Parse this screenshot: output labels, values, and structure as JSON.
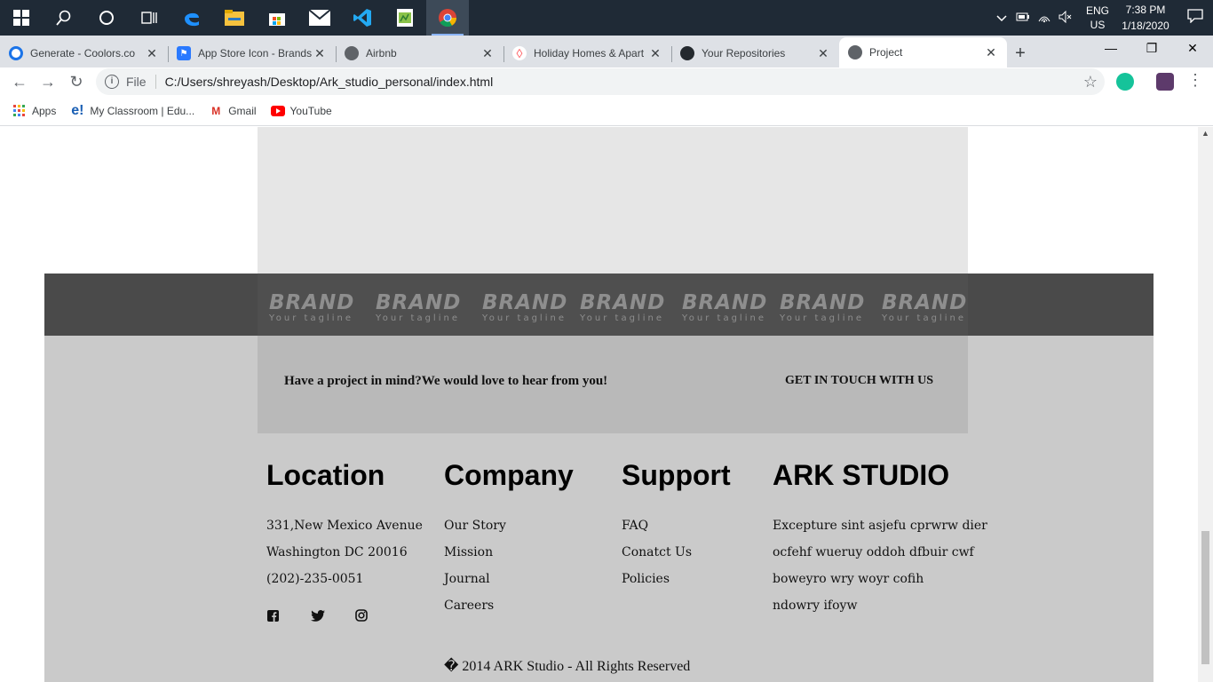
{
  "taskbar": {
    "colors": {
      "bg": "#1f2a36"
    },
    "icons": [
      "windows-icon",
      "search-icon",
      "cortana-icon",
      "task-view-icon",
      "edge-icon",
      "file-explorer-icon",
      "store-icon",
      "mail-icon",
      "vscode-icon",
      "notepad-icon",
      "chrome-icon"
    ],
    "lang_top": "ENG",
    "lang_bottom": "US",
    "time": "7:38 PM",
    "date": "1/18/2020"
  },
  "tabs": [
    {
      "title": "Generate - Coolors.co",
      "color": "#1a73e8"
    },
    {
      "title": "App Store Icon - Brands",
      "color": "#2979ff"
    },
    {
      "title": "Airbnb",
      "color": "#5f6368"
    },
    {
      "title": "Holiday Homes & Apart",
      "color": "#ff5a5f"
    },
    {
      "title": "Your Repositories",
      "color": "#24292e"
    },
    {
      "title": "Project",
      "color": "#5f6368"
    }
  ],
  "address": {
    "scheme": "File",
    "url": "C:/Users/shreyash/Desktop/Ark_studio_personal/index.html"
  },
  "bookmarks": [
    {
      "label": "Apps"
    },
    {
      "label": "My Classroom | Edu..."
    },
    {
      "label": "Gmail"
    },
    {
      "label": "YouTube"
    }
  ],
  "page": {
    "colors": {
      "footer_bg": "#cacaca",
      "brand_band": "#4a4a4a",
      "brand_text": "#8e8e8e"
    },
    "brands": [
      {
        "name": "BRAND",
        "tagline": "Your tagline"
      },
      {
        "name": "BRAND",
        "tagline": "Your tagline"
      },
      {
        "name": "BRAND",
        "tagline": "Your tagline"
      },
      {
        "name": "BRAND",
        "tagline": "Your tagline"
      },
      {
        "name": "BRAND",
        "tagline": "Your tagline"
      },
      {
        "name": "BRAND",
        "tagline": "Your tagline"
      },
      {
        "name": "BRAND",
        "tagline": "Your tagline"
      }
    ],
    "cta": {
      "text": "Have a project in mind?We would love to hear from you!",
      "link": "GET IN TOUCH WITH US"
    },
    "location": {
      "title": "Location",
      "lines": [
        "331,New Mexico Avenue",
        "Washington DC 20016",
        "(202)-235-0051"
      ]
    },
    "company": {
      "title": "Company",
      "links": [
        "Our Story",
        "Mission",
        "Journal",
        "Careers"
      ]
    },
    "support": {
      "title": "Support",
      "links": [
        "FAQ",
        "Conatct Us",
        "Policies"
      ]
    },
    "studio": {
      "title": "ARK STUDIO",
      "lines": [
        "Excepture sint asjefu cprwrw dier",
        "ocfehf wueruy oddoh dfbuir cwf",
        "boweyro wry woyr cofih",
        "ndowry ifoyw"
      ]
    },
    "social": [
      "facebook-icon",
      "twitter-icon",
      "instagram-icon"
    ],
    "copyright": "� 2014 ARK Studio - All Rights Reserved"
  }
}
